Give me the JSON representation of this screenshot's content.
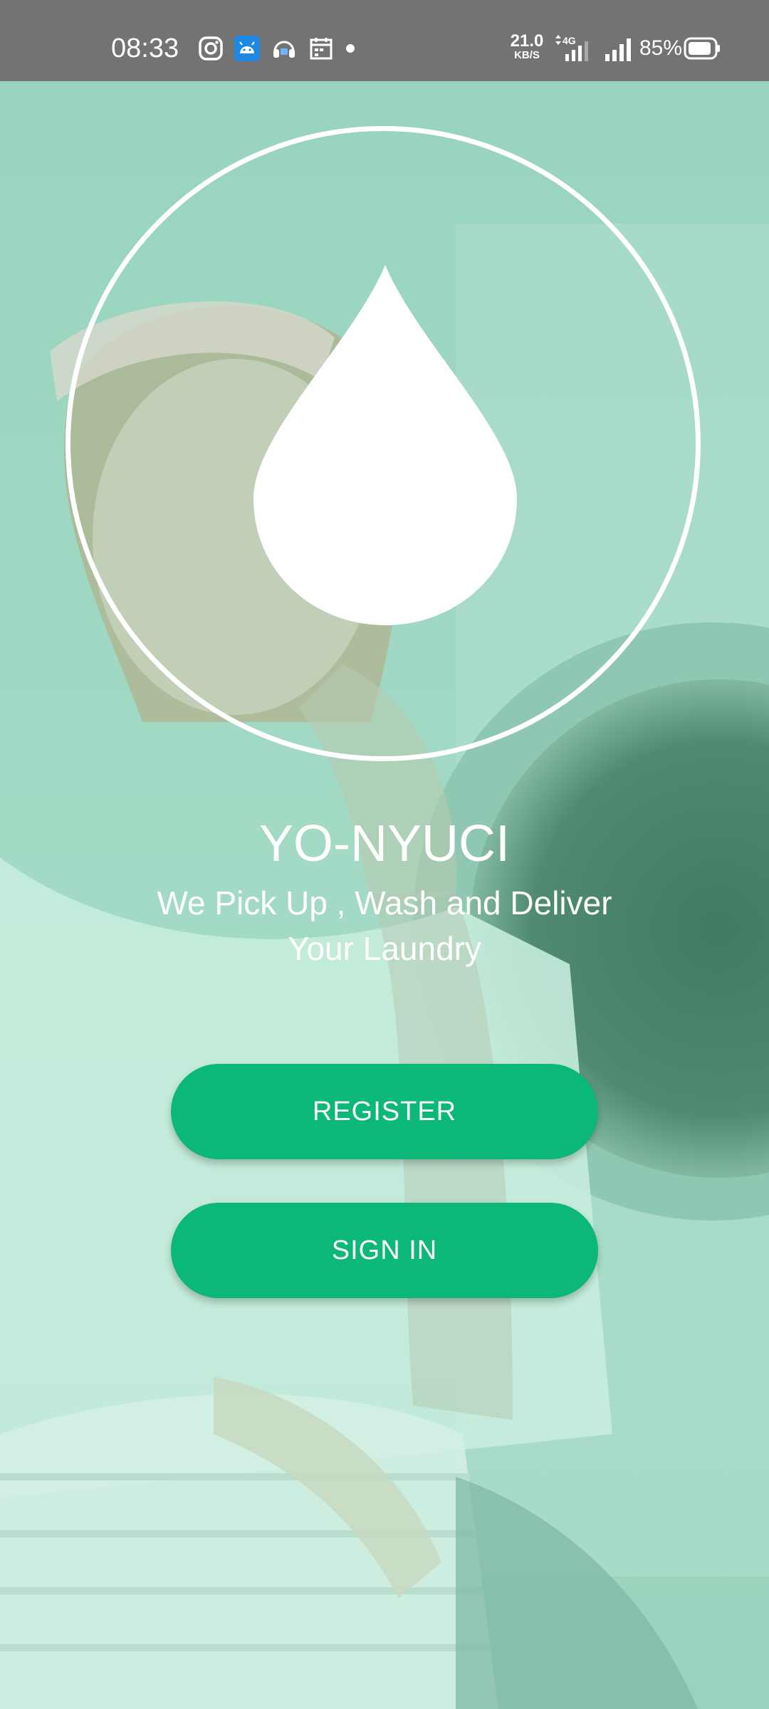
{
  "status_bar": {
    "time": "08:33",
    "icons": [
      "instagram-icon",
      "android-notification-icon",
      "headset-icon",
      "calendar-icon"
    ],
    "net_speed_value": "21.0",
    "net_speed_unit": "KB/S",
    "network_type": "4G",
    "battery_percent": "85%"
  },
  "app": {
    "title": "YO-NYUCI",
    "tagline": "We Pick Up , Wash and Deliver Your Laundry",
    "logo_icon": "water-drop-icon"
  },
  "actions": {
    "register_label": "REGISTER",
    "signin_label": "SIGN IN"
  },
  "colors": {
    "status_bar": "#737373",
    "overlay_tint": "#9fd8c2",
    "button": "#0bb877",
    "text": "#ffffff"
  }
}
